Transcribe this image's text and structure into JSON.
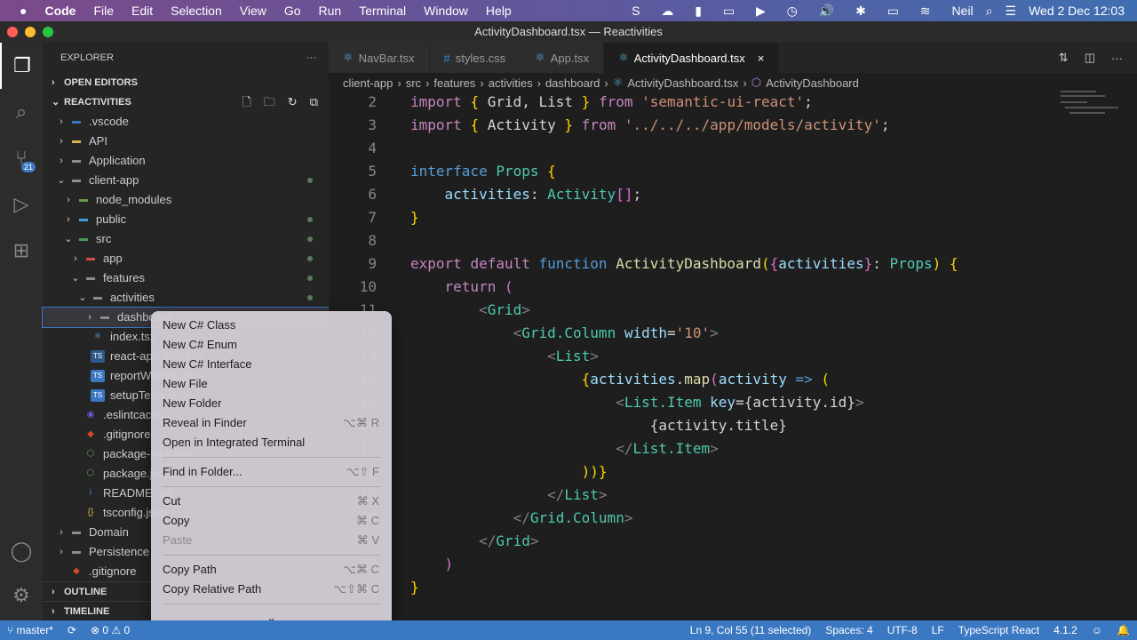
{
  "menubar": {
    "apple": "",
    "items": [
      "Code",
      "File",
      "Edit",
      "Selection",
      "View",
      "Go",
      "Run",
      "Terminal",
      "Window",
      "Help"
    ],
    "user": "Neil",
    "datetime": "Wed 2 Dec  12:03"
  },
  "window": {
    "title": "ActivityDashboard.tsx — Reactivities"
  },
  "activity_bar": {
    "scm_badge": "21"
  },
  "sidebar": {
    "title": "EXPLORER",
    "more": "···",
    "open_editors": "OPEN EDITORS",
    "project": "REACTIVITIES",
    "outline": "OUTLINE",
    "timeline": "TIMELINE",
    "tree": [
      {
        "label": ".vscode",
        "depth": 1,
        "chev": "›",
        "icon": "folder-vscode",
        "color": "#3b78c2"
      },
      {
        "label": "API",
        "depth": 1,
        "chev": "›",
        "icon": "folder",
        "color": "#d8b24a"
      },
      {
        "label": "Application",
        "depth": 1,
        "chev": "›",
        "icon": "folder",
        "color": "#8c8c8c"
      },
      {
        "label": "client-app",
        "depth": 1,
        "chev": "⌄",
        "icon": "folder-open",
        "color": "#8c8c8c",
        "dot": true
      },
      {
        "label": "node_modules",
        "depth": 2,
        "chev": "›",
        "icon": "folder-node",
        "color": "#6a9a4a"
      },
      {
        "label": "public",
        "depth": 2,
        "chev": "›",
        "icon": "folder-public",
        "color": "#3b9bd8",
        "dot": true
      },
      {
        "label": "src",
        "depth": 2,
        "chev": "⌄",
        "icon": "folder-src",
        "color": "#4a9a5a",
        "dot": true
      },
      {
        "label": "app",
        "depth": 3,
        "chev": "›",
        "icon": "folder-app",
        "color": "#d84a4a",
        "dot": true
      },
      {
        "label": "features",
        "depth": 3,
        "chev": "⌄",
        "icon": "folder",
        "color": "#8c8c8c",
        "dot": true
      },
      {
        "label": "activities",
        "depth": 4,
        "chev": "⌄",
        "icon": "folder",
        "color": "#8c8c8c",
        "dot": true
      },
      {
        "label": "dashboard",
        "depth": 5,
        "chev": "›",
        "icon": "folder",
        "color": "#8c8c8c",
        "selected": true
      },
      {
        "label": "index.tsx",
        "depth": 4,
        "chev": "",
        "icon": "react",
        "color": "#5aa8d8"
      },
      {
        "label": "react-app-env.d.ts",
        "depth": 4,
        "chev": "",
        "icon": "ts",
        "color": "#2d5a8a"
      },
      {
        "label": "reportWebVitals.ts",
        "depth": 4,
        "chev": "",
        "icon": "ts",
        "color": "#3b78c2"
      },
      {
        "label": "setupTests.ts",
        "depth": 4,
        "chev": "",
        "icon": "ts",
        "color": "#3b78c2"
      },
      {
        "label": ".eslintcache",
        "depth": 3,
        "chev": "",
        "icon": "eslint",
        "color": "#6a5ad8"
      },
      {
        "label": ".gitignore",
        "depth": 3,
        "chev": "",
        "icon": "git",
        "color": "#d8482a"
      },
      {
        "label": "package-lock.json",
        "depth": 3,
        "chev": "",
        "icon": "node",
        "color": "#5a9a4a"
      },
      {
        "label": "package.json",
        "depth": 3,
        "chev": "",
        "icon": "node",
        "color": "#5a9a4a"
      },
      {
        "label": "README.md",
        "depth": 3,
        "chev": "",
        "icon": "info",
        "color": "#3b88d8"
      },
      {
        "label": "tsconfig.json",
        "depth": 3,
        "chev": "",
        "icon": "json",
        "color": "#d8b24a"
      },
      {
        "label": "Domain",
        "depth": 1,
        "chev": "›",
        "icon": "folder",
        "color": "#8c8c8c"
      },
      {
        "label": "Persistence",
        "depth": 1,
        "chev": "›",
        "icon": "folder",
        "color": "#8c8c8c"
      },
      {
        "label": ".gitignore",
        "depth": 1,
        "chev": "",
        "icon": "git",
        "color": "#d8482a"
      }
    ]
  },
  "tabs": [
    {
      "label": "NavBar.tsx",
      "icon": "react"
    },
    {
      "label": "styles.css",
      "icon": "css"
    },
    {
      "label": "App.tsx",
      "icon": "react"
    },
    {
      "label": "ActivityDashboard.tsx",
      "icon": "react",
      "active": true,
      "close": "×"
    }
  ],
  "breadcrumb": [
    "client-app",
    "src",
    "features",
    "activities",
    "dashboard",
    "ActivityDashboard.tsx",
    "ActivityDashboard"
  ],
  "code": [
    {
      "n": "2",
      "t": [
        [
          "import ",
          "kw"
        ],
        [
          "{ ",
          "br"
        ],
        [
          "Grid, List ",
          "pu"
        ],
        [
          "} ",
          "br"
        ],
        [
          "from ",
          "kw"
        ],
        [
          "'semantic-ui-react'",
          "st"
        ],
        [
          ";",
          "pu"
        ]
      ]
    },
    {
      "n": "3",
      "t": [
        [
          "import ",
          "kw"
        ],
        [
          "{ ",
          "br"
        ],
        [
          "Activity ",
          "pu"
        ],
        [
          "} ",
          "br"
        ],
        [
          "from ",
          "kw"
        ],
        [
          "'../../../app/models/activity'",
          "st"
        ],
        [
          ";",
          "pu"
        ]
      ]
    },
    {
      "n": "4",
      "t": []
    },
    {
      "n": "5",
      "t": [
        [
          "interface ",
          "kb"
        ],
        [
          "Props ",
          "ty"
        ],
        [
          "{",
          "br"
        ]
      ]
    },
    {
      "n": "6",
      "t": [
        [
          "    activities",
          "va"
        ],
        [
          ": ",
          "pu"
        ],
        [
          "Activity",
          "ty"
        ],
        [
          "[]",
          "br2"
        ],
        [
          ";",
          "pu"
        ]
      ]
    },
    {
      "n": "7",
      "t": [
        [
          "}",
          "br"
        ]
      ]
    },
    {
      "n": "8",
      "t": []
    },
    {
      "n": "9",
      "t": [
        [
          "export ",
          "kw"
        ],
        [
          "default ",
          "kw"
        ],
        [
          "function ",
          "kb"
        ],
        [
          "ActivityDashboard",
          "fn"
        ],
        [
          "(",
          "br"
        ],
        [
          "{",
          "br2"
        ],
        [
          "activities",
          "va"
        ],
        [
          "}",
          "br2"
        ],
        [
          ": ",
          "pu"
        ],
        [
          "Props",
          "ty"
        ],
        [
          ") ",
          "br"
        ],
        [
          "{",
          "br"
        ]
      ]
    },
    {
      "n": "10",
      "t": [
        [
          "    return ",
          "kw"
        ],
        [
          "(",
          "br2"
        ]
      ]
    },
    {
      "n": "11",
      "t": [
        [
          "        <",
          "tg"
        ],
        [
          "Grid",
          "ty"
        ],
        [
          ">",
          "tg"
        ]
      ]
    },
    {
      "n": "12",
      "t": [
        [
          "            <",
          "tg"
        ],
        [
          "Grid.Column ",
          "ty"
        ],
        [
          "width",
          "va"
        ],
        [
          "=",
          "pu"
        ],
        [
          "'10'",
          "st"
        ],
        [
          ">",
          "tg"
        ]
      ]
    },
    {
      "n": "13",
      "t": [
        [
          "                <",
          "tg"
        ],
        [
          "List",
          "ty"
        ],
        [
          ">",
          "tg"
        ]
      ]
    },
    {
      "n": "14",
      "t": [
        [
          "                    {",
          "br"
        ],
        [
          "activities",
          "va"
        ],
        [
          ".",
          "pu"
        ],
        [
          "map",
          "fn"
        ],
        [
          "(",
          "br2"
        ],
        [
          "activity ",
          "va"
        ],
        [
          "=> ",
          "kb"
        ],
        [
          "(",
          "br"
        ]
      ]
    },
    {
      "n": "15",
      "t": [
        [
          "                        <",
          "tg"
        ],
        [
          "List.Item ",
          "ty"
        ],
        [
          "key",
          "va"
        ],
        [
          "=",
          "pu"
        ],
        [
          "{activity.id}",
          "pu"
        ],
        [
          ">",
          "tg"
        ]
      ]
    },
    {
      "n": "16",
      "t": [
        [
          "                            {activity.title}",
          "pu"
        ]
      ]
    },
    {
      "n": "17",
      "t": [
        [
          "                        </",
          "tg"
        ],
        [
          "List.Item",
          "ty"
        ],
        [
          ">",
          "tg"
        ]
      ]
    },
    {
      "n": "18",
      "t": [
        [
          "                    ))",
          "br"
        ],
        [
          "}",
          "br"
        ]
      ]
    },
    {
      "n": "19",
      "t": [
        [
          "                </",
          "tg"
        ],
        [
          "List",
          "ty"
        ],
        [
          ">",
          "tg"
        ]
      ]
    },
    {
      "n": "20",
      "t": [
        [
          "            </",
          "tg"
        ],
        [
          "Grid.Column",
          "ty"
        ],
        [
          ">",
          "tg"
        ]
      ]
    },
    {
      "n": "21",
      "t": [
        [
          "        </",
          "tg"
        ],
        [
          "Grid",
          "ty"
        ],
        [
          ">",
          "tg"
        ]
      ]
    },
    {
      "n": "22",
      "t": [
        [
          "    )",
          "br2"
        ]
      ]
    },
    {
      "n": "23",
      "t": [
        [
          "}",
          "br"
        ]
      ]
    }
  ],
  "context_menu": {
    "groups": [
      [
        {
          "label": "New C# Class"
        },
        {
          "label": "New C# Enum"
        },
        {
          "label": "New C# Interface"
        },
        {
          "label": "New File"
        },
        {
          "label": "New Folder"
        },
        {
          "label": "Reveal in Finder",
          "shortcut": "⌥⌘ R"
        },
        {
          "label": "Open in Integrated Terminal"
        }
      ],
      [
        {
          "label": "Find in Folder...",
          "shortcut": "⌥⇧ F"
        }
      ],
      [
        {
          "label": "Cut",
          "shortcut": "⌘ X"
        },
        {
          "label": "Copy",
          "shortcut": "⌘ C"
        },
        {
          "label": "Paste",
          "shortcut": "⌘ V",
          "disabled": true
        }
      ],
      [
        {
          "label": "Copy Path",
          "shortcut": "⌥⌘ C"
        },
        {
          "label": "Copy Relative Path",
          "shortcut": "⌥⇧⌘ C"
        }
      ]
    ],
    "more": "⌄"
  },
  "status": {
    "branch": "master*",
    "errors": "0",
    "warnings": "0",
    "position": "Ln 9, Col 55 (11 selected)",
    "spaces": "Spaces: 4",
    "encoding": "UTF-8",
    "eol": "LF",
    "language": "TypeScript React",
    "version": "4.1.2"
  }
}
